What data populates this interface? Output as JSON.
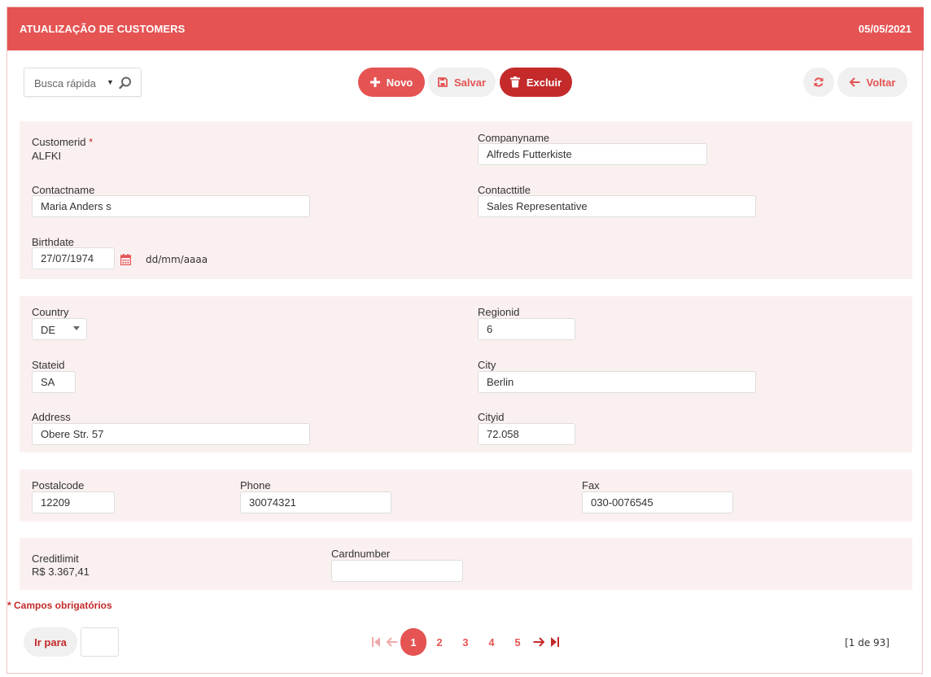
{
  "header": {
    "title": "ATUALIZAÇÃO DE CUSTOMERS",
    "date": "05/05/2021"
  },
  "toolbar": {
    "quick_search_placeholder": "Busca rápida",
    "novo_label": "Novo",
    "salvar_label": "Salvar",
    "excluir_label": "Excluir",
    "voltar_label": "Voltar"
  },
  "form": {
    "customerid": {
      "label": "Customerid",
      "required_mark": "*",
      "value": "ALFKI"
    },
    "companyname": {
      "label": "Companyname",
      "value": "Alfreds Futterkiste"
    },
    "contactname": {
      "label": "Contactname",
      "value": "Maria Anders s"
    },
    "contacttitle": {
      "label": "Contacttitle",
      "value": "Sales Representative"
    },
    "birthdate": {
      "label": "Birthdate",
      "value": "27/07/1974",
      "format_hint": "dd/mm/aaaa"
    },
    "country": {
      "label": "Country",
      "value": "DE"
    },
    "regionid": {
      "label": "Regionid",
      "value": "6"
    },
    "stateid": {
      "label": "Stateid",
      "value": "SA"
    },
    "city": {
      "label": "City",
      "value": "Berlin"
    },
    "address": {
      "label": "Address",
      "value": "Obere Str. 57"
    },
    "cityid": {
      "label": "Cityid",
      "value": "72.058"
    },
    "postalcode": {
      "label": "Postalcode",
      "value": "12209"
    },
    "phone": {
      "label": "Phone",
      "value": "30074321"
    },
    "fax": {
      "label": "Fax",
      "value": "030-0076545"
    },
    "creditlimit": {
      "label": "Creditlimit",
      "value": "R$ 3.367,41"
    },
    "cardnumber": {
      "label": "Cardnumber",
      "value": ""
    }
  },
  "required_note": "* Campos obrigatórios",
  "footer": {
    "goto_label": "Ir para",
    "goto_value": "",
    "pages": [
      "1",
      "2",
      "3",
      "4",
      "5"
    ],
    "current_page": "1",
    "page_info": "[1 de 93]"
  },
  "colors": {
    "primary": "#e55353",
    "danger": "#c42a2a",
    "section_bg": "#fbf0f0",
    "button_light": "#f0f0f0"
  },
  "icons": [
    "search-icon",
    "plus-icon",
    "save-icon",
    "trash-icon",
    "refresh-icon",
    "arrow-left-icon",
    "calendar-icon",
    "first-page-icon",
    "prev-page-icon",
    "next-page-icon",
    "last-page-icon"
  ]
}
